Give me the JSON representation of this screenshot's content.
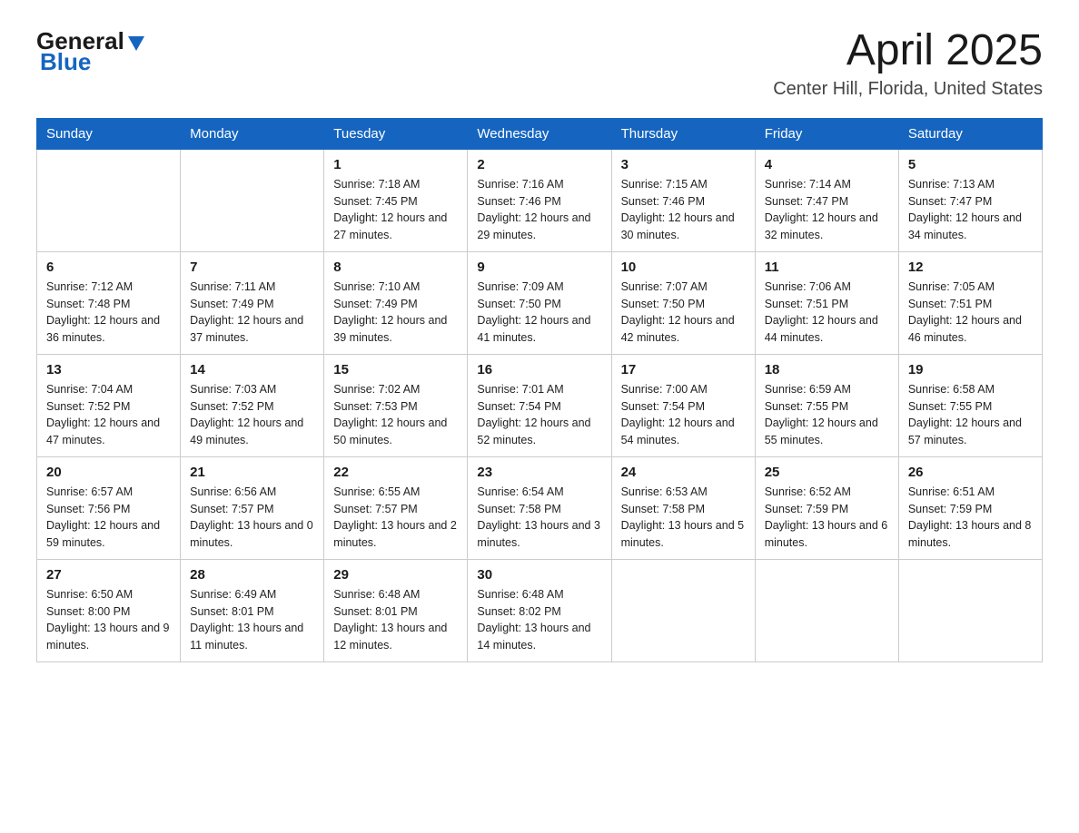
{
  "header": {
    "logo": {
      "general": "General",
      "blue": "Blue"
    },
    "title": "April 2025",
    "location": "Center Hill, Florida, United States"
  },
  "weekdays": [
    "Sunday",
    "Monday",
    "Tuesday",
    "Wednesday",
    "Thursday",
    "Friday",
    "Saturday"
  ],
  "weeks": [
    [
      {
        "day": "",
        "sunrise": "",
        "sunset": "",
        "daylight": ""
      },
      {
        "day": "",
        "sunrise": "",
        "sunset": "",
        "daylight": ""
      },
      {
        "day": "1",
        "sunrise": "Sunrise: 7:18 AM",
        "sunset": "Sunset: 7:45 PM",
        "daylight": "Daylight: 12 hours and 27 minutes."
      },
      {
        "day": "2",
        "sunrise": "Sunrise: 7:16 AM",
        "sunset": "Sunset: 7:46 PM",
        "daylight": "Daylight: 12 hours and 29 minutes."
      },
      {
        "day": "3",
        "sunrise": "Sunrise: 7:15 AM",
        "sunset": "Sunset: 7:46 PM",
        "daylight": "Daylight: 12 hours and 30 minutes."
      },
      {
        "day": "4",
        "sunrise": "Sunrise: 7:14 AM",
        "sunset": "Sunset: 7:47 PM",
        "daylight": "Daylight: 12 hours and 32 minutes."
      },
      {
        "day": "5",
        "sunrise": "Sunrise: 7:13 AM",
        "sunset": "Sunset: 7:47 PM",
        "daylight": "Daylight: 12 hours and 34 minutes."
      }
    ],
    [
      {
        "day": "6",
        "sunrise": "Sunrise: 7:12 AM",
        "sunset": "Sunset: 7:48 PM",
        "daylight": "Daylight: 12 hours and 36 minutes."
      },
      {
        "day": "7",
        "sunrise": "Sunrise: 7:11 AM",
        "sunset": "Sunset: 7:49 PM",
        "daylight": "Daylight: 12 hours and 37 minutes."
      },
      {
        "day": "8",
        "sunrise": "Sunrise: 7:10 AM",
        "sunset": "Sunset: 7:49 PM",
        "daylight": "Daylight: 12 hours and 39 minutes."
      },
      {
        "day": "9",
        "sunrise": "Sunrise: 7:09 AM",
        "sunset": "Sunset: 7:50 PM",
        "daylight": "Daylight: 12 hours and 41 minutes."
      },
      {
        "day": "10",
        "sunrise": "Sunrise: 7:07 AM",
        "sunset": "Sunset: 7:50 PM",
        "daylight": "Daylight: 12 hours and 42 minutes."
      },
      {
        "day": "11",
        "sunrise": "Sunrise: 7:06 AM",
        "sunset": "Sunset: 7:51 PM",
        "daylight": "Daylight: 12 hours and 44 minutes."
      },
      {
        "day": "12",
        "sunrise": "Sunrise: 7:05 AM",
        "sunset": "Sunset: 7:51 PM",
        "daylight": "Daylight: 12 hours and 46 minutes."
      }
    ],
    [
      {
        "day": "13",
        "sunrise": "Sunrise: 7:04 AM",
        "sunset": "Sunset: 7:52 PM",
        "daylight": "Daylight: 12 hours and 47 minutes."
      },
      {
        "day": "14",
        "sunrise": "Sunrise: 7:03 AM",
        "sunset": "Sunset: 7:52 PM",
        "daylight": "Daylight: 12 hours and 49 minutes."
      },
      {
        "day": "15",
        "sunrise": "Sunrise: 7:02 AM",
        "sunset": "Sunset: 7:53 PM",
        "daylight": "Daylight: 12 hours and 50 minutes."
      },
      {
        "day": "16",
        "sunrise": "Sunrise: 7:01 AM",
        "sunset": "Sunset: 7:54 PM",
        "daylight": "Daylight: 12 hours and 52 minutes."
      },
      {
        "day": "17",
        "sunrise": "Sunrise: 7:00 AM",
        "sunset": "Sunset: 7:54 PM",
        "daylight": "Daylight: 12 hours and 54 minutes."
      },
      {
        "day": "18",
        "sunrise": "Sunrise: 6:59 AM",
        "sunset": "Sunset: 7:55 PM",
        "daylight": "Daylight: 12 hours and 55 minutes."
      },
      {
        "day": "19",
        "sunrise": "Sunrise: 6:58 AM",
        "sunset": "Sunset: 7:55 PM",
        "daylight": "Daylight: 12 hours and 57 minutes."
      }
    ],
    [
      {
        "day": "20",
        "sunrise": "Sunrise: 6:57 AM",
        "sunset": "Sunset: 7:56 PM",
        "daylight": "Daylight: 12 hours and 59 minutes."
      },
      {
        "day": "21",
        "sunrise": "Sunrise: 6:56 AM",
        "sunset": "Sunset: 7:57 PM",
        "daylight": "Daylight: 13 hours and 0 minutes."
      },
      {
        "day": "22",
        "sunrise": "Sunrise: 6:55 AM",
        "sunset": "Sunset: 7:57 PM",
        "daylight": "Daylight: 13 hours and 2 minutes."
      },
      {
        "day": "23",
        "sunrise": "Sunrise: 6:54 AM",
        "sunset": "Sunset: 7:58 PM",
        "daylight": "Daylight: 13 hours and 3 minutes."
      },
      {
        "day": "24",
        "sunrise": "Sunrise: 6:53 AM",
        "sunset": "Sunset: 7:58 PM",
        "daylight": "Daylight: 13 hours and 5 minutes."
      },
      {
        "day": "25",
        "sunrise": "Sunrise: 6:52 AM",
        "sunset": "Sunset: 7:59 PM",
        "daylight": "Daylight: 13 hours and 6 minutes."
      },
      {
        "day": "26",
        "sunrise": "Sunrise: 6:51 AM",
        "sunset": "Sunset: 7:59 PM",
        "daylight": "Daylight: 13 hours and 8 minutes."
      }
    ],
    [
      {
        "day": "27",
        "sunrise": "Sunrise: 6:50 AM",
        "sunset": "Sunset: 8:00 PM",
        "daylight": "Daylight: 13 hours and 9 minutes."
      },
      {
        "day": "28",
        "sunrise": "Sunrise: 6:49 AM",
        "sunset": "Sunset: 8:01 PM",
        "daylight": "Daylight: 13 hours and 11 minutes."
      },
      {
        "day": "29",
        "sunrise": "Sunrise: 6:48 AM",
        "sunset": "Sunset: 8:01 PM",
        "daylight": "Daylight: 13 hours and 12 minutes."
      },
      {
        "day": "30",
        "sunrise": "Sunrise: 6:48 AM",
        "sunset": "Sunset: 8:02 PM",
        "daylight": "Daylight: 13 hours and 14 minutes."
      },
      {
        "day": "",
        "sunrise": "",
        "sunset": "",
        "daylight": ""
      },
      {
        "day": "",
        "sunrise": "",
        "sunset": "",
        "daylight": ""
      },
      {
        "day": "",
        "sunrise": "",
        "sunset": "",
        "daylight": ""
      }
    ]
  ]
}
